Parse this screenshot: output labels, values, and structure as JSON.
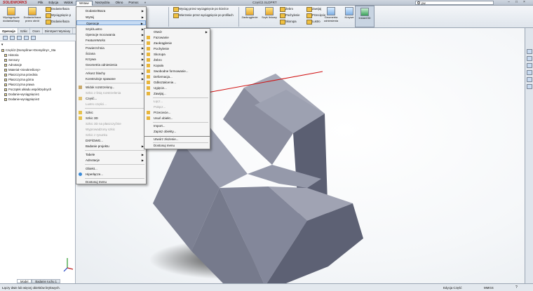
{
  "app": {
    "logo": "SOLIDWORKS",
    "doc_title": "Część2.SLDPRT"
  },
  "menubar": [
    "Plik",
    "Edycja",
    "Widok",
    "Wstaw",
    "Narzędzia",
    "Okno",
    "Pomoc",
    "»"
  ],
  "search": {
    "value": "pw"
  },
  "cmd": {
    "t1": "Wyciągnięcie dodania/bazy",
    "t2": "Dodanie/baza przez obrót",
    "s1": "Dodanie/baza",
    "s2": "Wyciągnięcie p",
    "s3": "Dodanie/baza",
    "t3": "Zaokrąglenie",
    "t4": "Szyk liniowy",
    "s4": "Żebro",
    "s5": "Pochylenie",
    "s6": "Skorupa",
    "s7": "Zawijaj",
    "s8": "Przecięcie",
    "s9": "Lustro",
    "t5": "Geometria odniesienia",
    "t6": "Krzywe",
    "t7": "Instant3D",
    "s10": "Wyciąg przez wyciągnięcie po ścieżce",
    "s11": "Wierzenie przez wyciągnięcie po profilach",
    "s12": "Wierzenie przez wyciągnięcie po profilach",
    "m1": "Wierz",
    "m2": "Wiercenie"
  },
  "tabs": [
    "Operacje",
    "Szkic",
    "Ocen",
    "DimXpert Wymiary"
  ],
  "tree": [
    "Część2 (Domyślna<<Domyślny>_Sta",
    "Historia",
    "Sensory",
    "Adnotacje",
    "Materiał <nieokreślony>",
    "Płaszczyzna przednia",
    "Płaszczyzna górna",
    "Płaszczyzna prawa",
    "Początek układu współrzędnych",
    "Dodanie-wyciągnięcie1",
    "Dodanie-wyciągnięcie2"
  ],
  "insert_menu": [
    "Dodanie/Baza",
    "Wytnij",
    "Operacje",
    "Szyk/Lustro",
    "Operacje mocowania",
    "FeatureWorks",
    "Powierzchnia",
    "Ściana",
    "Krzywa",
    "Geometria odniesienia",
    "Arkusz blachy",
    "Konstrukcje spawane",
    "Widok rozstrzelony...",
    "Szkic z linią rozstrzelenia",
    "Część...",
    "Lustro części...",
    "Szkic",
    "Szkic 3D",
    "Szkic 3D na płaszczyźnie",
    "Wyprowadzony szkic",
    "Szkic z rysunku",
    "DXF/DWG...",
    "Badanie projektu",
    "Tabele",
    "Adnotacje",
    "Obiekt...",
    "Hiperłącze...",
    "Dostosuj menu"
  ],
  "ops_menu": [
    "Otwór",
    "Fazowanie",
    "Zaokrąglenie",
    "Pochylenie",
    "Skorupa",
    "Żebro",
    "Kopuła",
    "Swobodne formowanie...",
    "Deformacja...",
    "Odkształcenie...",
    "Ugięcie...",
    "Zawijaj...",
    "Łącz...",
    "Połącz...",
    "Przeciecie...",
    "Usuń obiekt...",
    "Import...",
    "Zapisz obiekty...",
    "Utwórz złożenie...",
    "Dostosuj menu"
  ],
  "bottom_tabs": [
    "Model",
    "Badanie ruchu 1"
  ],
  "status": {
    "left": "Łączy dwie lub więcej obiektów bryłowych.",
    "mid": "Edycja Część",
    "units": "MMGS"
  },
  "colors": {
    "accent": "#c6dbf3",
    "arrow": "#d01010",
    "solid": "#6b6f80"
  }
}
